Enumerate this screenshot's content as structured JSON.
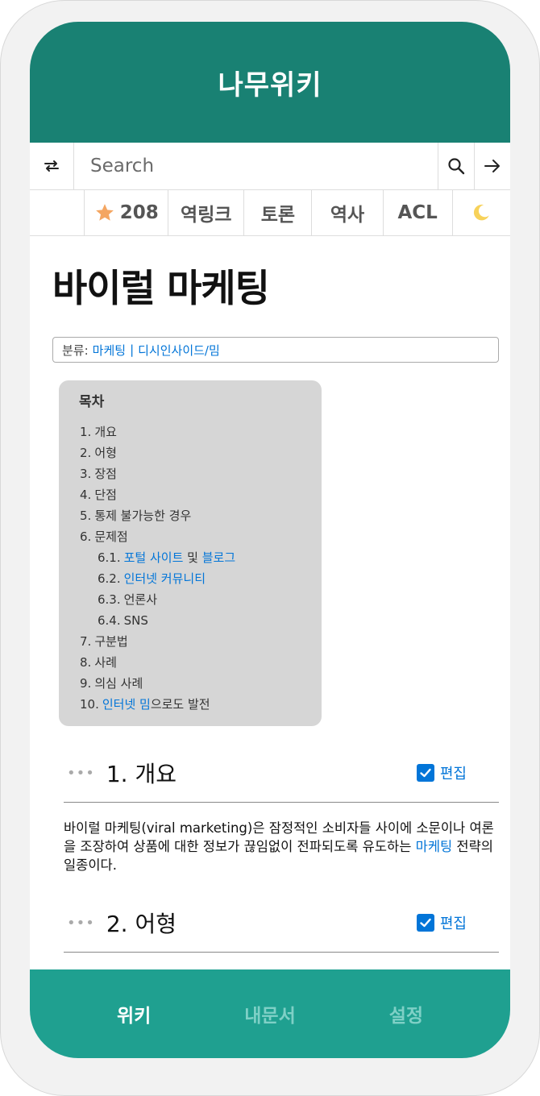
{
  "header": {
    "title": "나무위키"
  },
  "search": {
    "placeholder": "Search"
  },
  "toolbar": {
    "star_count": "208",
    "backlinks": "역링크",
    "discussion": "토론",
    "history": "역사",
    "acl": "ACL"
  },
  "page": {
    "title": "바이럴 마케팅",
    "category_label": "분류:",
    "categories": [
      "마케팅",
      "디시인사이드/밈"
    ]
  },
  "toc": {
    "title": "목차",
    "items": [
      {
        "num": "1.",
        "text": "개요"
      },
      {
        "num": "2.",
        "text": "어형"
      },
      {
        "num": "3.",
        "text": "장점"
      },
      {
        "num": "4.",
        "text": "단점"
      },
      {
        "num": "5.",
        "text": "통제 불가능한 경우"
      },
      {
        "num": "6.",
        "text": "문제점"
      },
      {
        "num": "6.1.",
        "link1": "포털 사이트",
        "mid": " 및 ",
        "link2": "블로그"
      },
      {
        "num": "6.2.",
        "link1": "인터넷 커뮤니티"
      },
      {
        "num": "6.3.",
        "text": "언론사"
      },
      {
        "num": "6.4.",
        "text": "SNS"
      },
      {
        "num": "7.",
        "text": "구분법"
      },
      {
        "num": "8.",
        "text": "사례"
      },
      {
        "num": "9.",
        "text": "의심 사례"
      },
      {
        "num": "10.",
        "link1": "인터넷 밈",
        "tail": "으로도 발전"
      }
    ]
  },
  "sections": [
    {
      "title": "1. 개요",
      "edit": "편집",
      "text_before": "바이럴 마케팅(viral marketing)은 잠정적인 소비자들 사이에 소문이나 여론을 조장하여 상품에 대한 정보가 끊임없이 전파되도록 유도하는 ",
      "link": "마케팅",
      "text_after": " 전략의 일종이다."
    },
    {
      "title": "2. 어형",
      "edit": "편집"
    }
  ],
  "bottom_nav": {
    "wiki": "위키",
    "my_docs": "내문서",
    "settings": "설정"
  },
  "colors": {
    "header": "#198173",
    "bottom_nav": "#1fa090",
    "link": "#0275d8",
    "toc_bg": "#d6d6d6"
  },
  "icons": [
    "random-icon",
    "search-icon",
    "arrow-right-icon",
    "star-icon",
    "moon-icon",
    "checkbox-icon"
  ]
}
